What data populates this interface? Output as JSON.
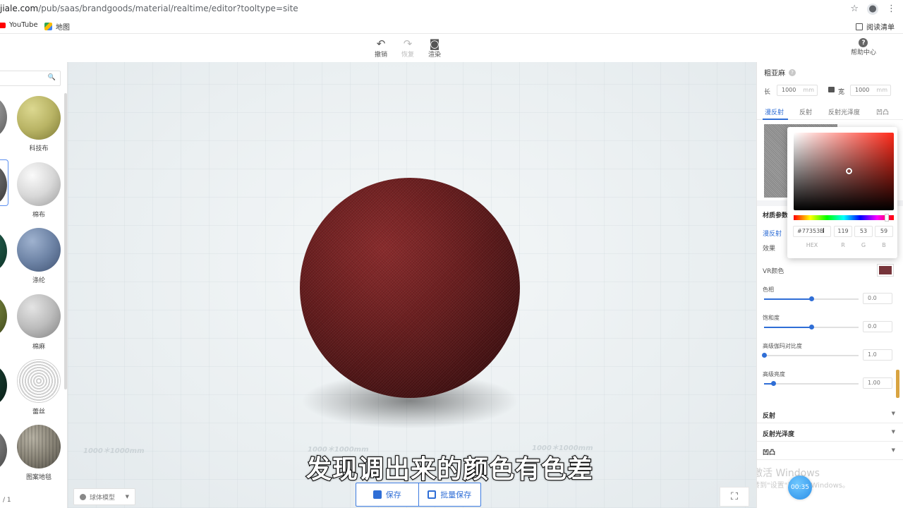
{
  "browser": {
    "url_host": "jiale.com",
    "url_path": "/pub/saas/brandgoods/material/realtime/editor?tooltype=site",
    "bookmarks": [
      {
        "label": "YouTube"
      },
      {
        "label": "地图"
      }
    ],
    "reading_list": "阅读清单",
    "icons": {
      "star": "star-icon",
      "profile": "profile-icon",
      "menu": "kebab-menu-icon"
    }
  },
  "toolbar": {
    "undo": "撤销",
    "redo": "恢复",
    "render": "渲染",
    "help": "帮助中心"
  },
  "left_panel": {
    "search_placeholder": "",
    "materials": [
      {
        "name": "科技布",
        "color": "#b9b465"
      },
      {
        "name": "棉布",
        "color": "#d8d8d8"
      },
      {
        "name": "涤纶",
        "color": "#6e84a6"
      },
      {
        "name": "棉麻",
        "color": "#bcbcbc"
      },
      {
        "name": "蕾丝",
        "color": "#e6e6e6"
      },
      {
        "name": "图案地毯",
        "color": "#8a8578"
      }
    ],
    "pager": "/   1"
  },
  "viewport": {
    "floor_labels": [
      "1000＊1000mm",
      "1000＊1000mm",
      "1000＊1000mm"
    ],
    "model_select": "球体模型",
    "save_label": "保存",
    "batch_save_label": "批量保存",
    "subtitle": "发现调出来的颜色有色差"
  },
  "right_panel": {
    "title": "粗亚麻",
    "length_label": "长",
    "width_label": "宽",
    "length_value": "1000",
    "width_value": "1000",
    "unit": "mm",
    "tabs": [
      "漫反射",
      "反射",
      "反射光泽度",
      "凹凸"
    ],
    "active_tab": 0,
    "section_title": "材质参数",
    "sub_tab": "漫反射",
    "effect_label": "效果",
    "vr_color_label": "VR颜色",
    "vr_color": "#77353b",
    "sliders": [
      {
        "label": "色相",
        "value": "0.0",
        "fraction": 0.5
      },
      {
        "label": "饱和度",
        "value": "0.0",
        "fraction": 0.5
      },
      {
        "label": "高级伽玛对比度",
        "value": "1.0",
        "fraction": 0.0
      },
      {
        "label": "高级亮度",
        "value": "1.00",
        "fraction": 0.1
      }
    ],
    "collapsed_sections": [
      "反射",
      "反射光泽度",
      "凹凸"
    ],
    "watermark_line1": "激活 Windows",
    "watermark_line2": "转到\"设置\"以激活 Windows。",
    "timer": "00:35"
  },
  "color_picker": {
    "hex": "#77353B",
    "r": "119",
    "g": "53",
    "b": "59",
    "labels": {
      "hex": "HEX",
      "r": "R",
      "g": "G",
      "b": "B"
    },
    "hue_color": "#ff2a1a"
  }
}
